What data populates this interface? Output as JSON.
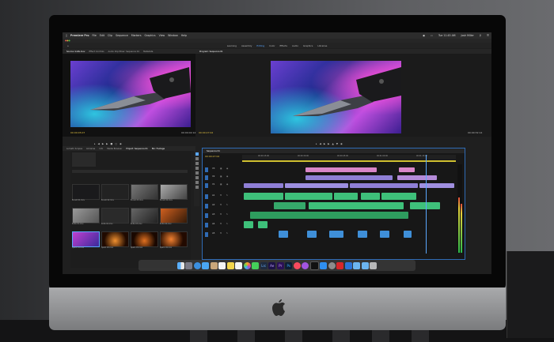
{
  "menubar": {
    "app_name": "Premiere Pro",
    "items": [
      "File",
      "Edit",
      "Clip",
      "Sequence",
      "Markers",
      "Graphics",
      "View",
      "Window",
      "Help"
    ],
    "clock": "Tue 11:45 AM",
    "user": "Josh Miller"
  },
  "workspaces": {
    "items": [
      "Learning",
      "Assembly",
      "Editing",
      "Color",
      "Effects",
      "Audio",
      "Graphics",
      "Libraries"
    ],
    "active_index": 2
  },
  "source_monitor": {
    "tabs": [
      "Source: knife.mov",
      "Effect Controls",
      "Audio Clip Mixer: Sequence 01",
      "Metadata"
    ],
    "timecode_in": "00:00:05:07",
    "timecode_out": "00:00:02:14"
  },
  "program_monitor": {
    "tab": "Program: Sequence 01",
    "timecode_in": "00:00:27:02",
    "timecode_out": "00:00:32:14"
  },
  "project_panel": {
    "tabs": [
      "Lumetri Scopes",
      "Libraries",
      "Info",
      "Media Browser",
      "Project: Sequence 01"
    ],
    "bin_tab": "Bin: Footage",
    "items": [
      {
        "label": "B-cam 01.mov"
      },
      {
        "label": "B-cam 02.mov"
      },
      {
        "label": "B-cam 03.mov"
      },
      {
        "label": "B-cam 04.mov"
      },
      {
        "label": "Knife 01.mov"
      },
      {
        "label": "Knife 02.mov"
      },
      {
        "label": "Knife 03.mov"
      },
      {
        "label": "Knife 04.mov"
      },
      {
        "label": "Spark 01.mov"
      },
      {
        "label": "Spark 02.mov"
      },
      {
        "label": "Spark 03.mov"
      },
      {
        "label": "Spark 04.mov"
      }
    ]
  },
  "timeline": {
    "tab": "Sequence 01",
    "timecode": "00:00:27:02",
    "ruler_marks": [
      "00:00:15:00",
      "00:00:30:00",
      "00:00:45:00",
      "00:01:00:00",
      "00:01:15:00"
    ],
    "video_tracks": [
      "V3",
      "V2",
      "V1"
    ],
    "audio_tracks": [
      "A1",
      "A2",
      "A3",
      "A4",
      "A5"
    ]
  },
  "dock": {
    "apps": [
      "Finder",
      "Launchpad",
      "Safari",
      "Mail",
      "Contacts",
      "Calendar",
      "Notes",
      "Reminders",
      "Photos",
      "Messages",
      "Lightroom Classic",
      "After Effects",
      "Premiere Pro",
      "Photoshop",
      "Music",
      "Podcasts",
      "TV",
      "App Store",
      "System Preferences",
      "Acrobat",
      "Keynote",
      "Folder",
      "Downloads",
      "Trash"
    ]
  },
  "colors": {
    "accent": "#2f6bb5",
    "timecode": "#e0c040",
    "video_clip": "#8f7fd6",
    "audio_clip": "#3ec07a"
  }
}
